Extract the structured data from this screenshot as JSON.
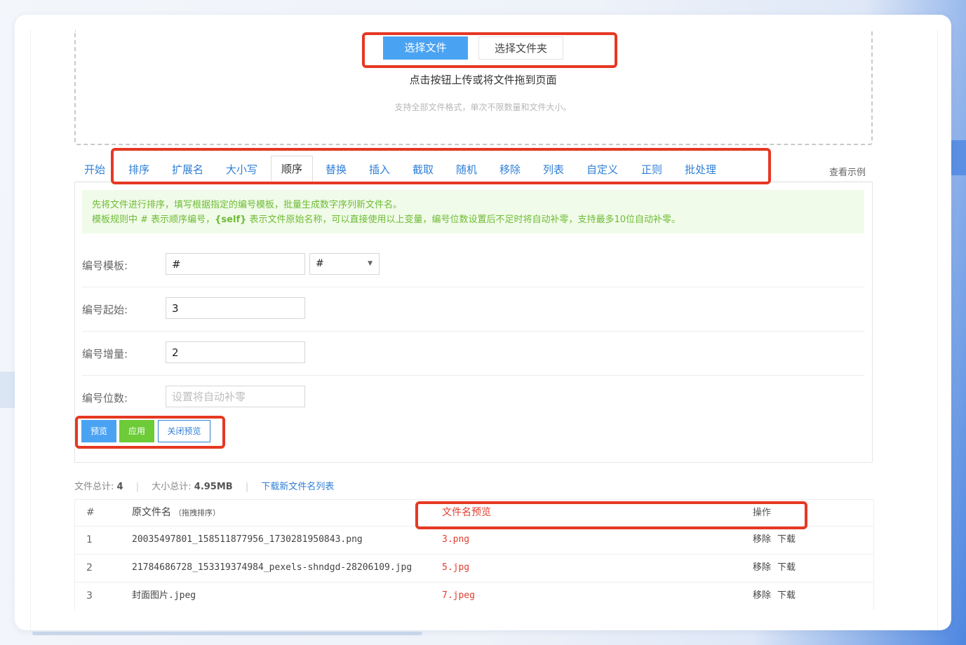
{
  "upload": {
    "choose_file": "选择文件",
    "choose_folder": "选择文件夹",
    "hint_main": "点击按钮上传或将文件拖到页面",
    "hint_sub": "支持全部文件格式，单次不限数量和文件大小。"
  },
  "tabs": {
    "items": [
      "开始",
      "排序",
      "扩展名",
      "大小写",
      "顺序",
      "替换",
      "插入",
      "截取",
      "随机",
      "移除",
      "列表",
      "自定义",
      "正则",
      "批处理"
    ],
    "active_index": 4,
    "see_example": "查看示例"
  },
  "notice": {
    "line1": "先将文件进行排序，填写根据指定的编号模板，批量生成数字序列新文件名。",
    "line2_a": "模板规则中 # 表示顺序编号，",
    "line2_b": "{self}",
    "line2_c": " 表示文件原始名称，可以直接使用以上变量，编号位数设置后不足时将自动补零，支持最多10位自动补零。"
  },
  "form": {
    "template_label": "编号模板:",
    "template_value": "#",
    "template_select": "#",
    "start_label": "编号起始:",
    "start_value": "3",
    "step_label": "编号增量:",
    "step_value": "2",
    "digits_label": "编号位数:",
    "digits_placeholder": "设置将自动补零"
  },
  "actions": {
    "preview": "预览",
    "apply": "应用",
    "close_preview": "关闭预览"
  },
  "stats": {
    "file_total_label": "文件总计:",
    "file_total": "4",
    "size_total_label": "大小总计:",
    "size_total": "4.95MB",
    "download_link": "下载新文件名列表"
  },
  "table": {
    "headers": {
      "idx": "#",
      "orig": "原文件名",
      "orig_hint": "（拖拽排序）",
      "preview": "文件名预览",
      "ops": "操作"
    },
    "rows": [
      {
        "idx": "1",
        "orig": "20035497801_158511877956_1730281950843.png",
        "preview": "3.png",
        "remove": "移除",
        "download": "下载"
      },
      {
        "idx": "2",
        "orig": "21784686728_153319374984_pexels-shndgd-28206109.jpg",
        "preview": "5.jpg",
        "remove": "移除",
        "download": "下载"
      },
      {
        "idx": "3",
        "orig": "封面图片.jpeg",
        "preview": "7.jpeg",
        "remove": "移除",
        "download": "下载"
      }
    ]
  },
  "colors": {
    "primary": "#4aa3f2",
    "success": "#6ccb37",
    "link": "#2f7fd6",
    "highlight_box": "#e63823",
    "preview_text": "#e23d2e"
  }
}
